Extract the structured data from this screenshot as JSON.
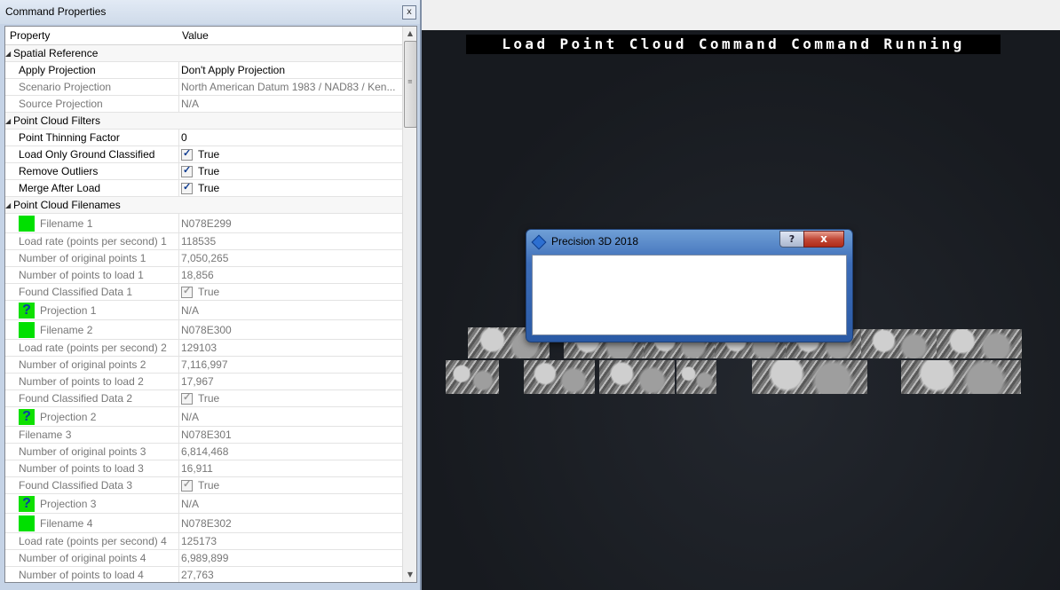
{
  "panel": {
    "title": "Command Properties",
    "close_label": "x",
    "header": {
      "property": "Property",
      "value": "Value"
    },
    "rows": [
      {
        "kind": "cat",
        "label": "Spatial Reference"
      },
      {
        "kind": "black",
        "label": "Apply Projection",
        "value": "Don't Apply Projection"
      },
      {
        "kind": "gray",
        "label": "Scenario Projection",
        "value": "North American Datum 1983 / NAD83 / Ken..."
      },
      {
        "kind": "gray",
        "label": "Source Projection",
        "value": "N/A"
      },
      {
        "kind": "cat",
        "label": "Point Cloud Filters"
      },
      {
        "kind": "black",
        "label": "Point Thinning Factor",
        "value": "0"
      },
      {
        "kind": "black",
        "label": "Load Only Ground Classified",
        "value": "True",
        "check": true
      },
      {
        "kind": "black",
        "label": "Remove Outliers",
        "value": "True",
        "check": true
      },
      {
        "kind": "black",
        "label": "Merge After Load",
        "value": "True",
        "check": true
      },
      {
        "kind": "cat",
        "label": "Point Cloud Filenames"
      },
      {
        "kind": "gray",
        "label": "Filename 1",
        "value": "N078E299",
        "swatch": "green"
      },
      {
        "kind": "gray",
        "label": "Load rate (points per second) 1",
        "value": "118535"
      },
      {
        "kind": "gray",
        "label": "Number of original points 1",
        "value": "7,050,265"
      },
      {
        "kind": "gray",
        "label": "Number of points to load 1",
        "value": "18,856"
      },
      {
        "kind": "gray",
        "label": "Found Classified Data 1",
        "value": "True",
        "check": true
      },
      {
        "kind": "gray",
        "label": "Projection 1",
        "value": "N/A",
        "swatch": "question"
      },
      {
        "kind": "gray",
        "label": "Filename 2",
        "value": "N078E300",
        "swatch": "green"
      },
      {
        "kind": "gray",
        "label": "Load rate (points per second) 2",
        "value": "129103"
      },
      {
        "kind": "gray",
        "label": "Number of original points 2",
        "value": "7,116,997"
      },
      {
        "kind": "gray",
        "label": "Number of points to load 2",
        "value": "17,967"
      },
      {
        "kind": "gray",
        "label": "Found Classified Data 2",
        "value": "True",
        "check": true
      },
      {
        "kind": "gray",
        "label": "Projection 2",
        "value": "N/A",
        "swatch": "question"
      },
      {
        "kind": "gray",
        "label": "Filename 3",
        "value": "N078E301"
      },
      {
        "kind": "gray",
        "label": "Number of original points 3",
        "value": "6,814,468"
      },
      {
        "kind": "gray",
        "label": "Number of points to load 3",
        "value": "16,911"
      },
      {
        "kind": "gray",
        "label": "Found Classified Data 3",
        "value": "True",
        "check": true
      },
      {
        "kind": "gray",
        "label": "Projection 3",
        "value": "N/A",
        "swatch": "question"
      },
      {
        "kind": "gray",
        "label": "Filename 4",
        "value": "N078E302",
        "swatch": "green"
      },
      {
        "kind": "gray",
        "label": "Load rate (points per second) 4",
        "value": "125173"
      },
      {
        "kind": "gray",
        "label": "Number of original points 4",
        "value": "6,989,899"
      },
      {
        "kind": "gray",
        "label": "Number of points to load 4",
        "value": "27,763"
      }
    ]
  },
  "viewport": {
    "banner": "Load Point Cloud Command Command Running"
  },
  "dialog": {
    "title": "Precision 3D 2018",
    "help_label": "?",
    "close_label": "x"
  },
  "colors": {
    "swatch_green": "#00e000",
    "question_blue": "#0b3aa8",
    "viewport_bg": "#1a1d22"
  }
}
